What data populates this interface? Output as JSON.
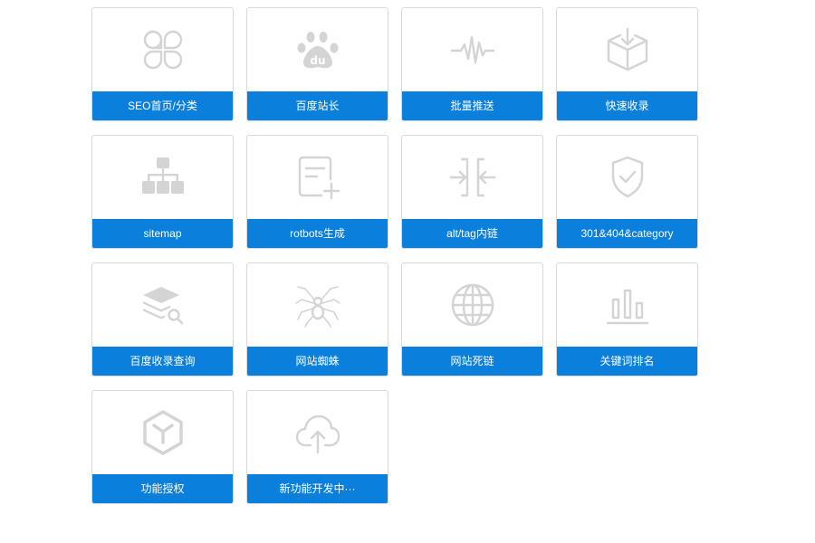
{
  "tools": [
    {
      "label": "SEO首页/分类",
      "icon": "clover-icon"
    },
    {
      "label": "百度站长",
      "icon": "baidu-paw-icon"
    },
    {
      "label": "批量推送",
      "icon": "pulse-wave-icon"
    },
    {
      "label": "快速收录",
      "icon": "box-download-icon"
    },
    {
      "label": "sitemap",
      "icon": "sitemap-icon"
    },
    {
      "label": "rotbots生成",
      "icon": "document-add-icon"
    },
    {
      "label": "alt/tag内链",
      "icon": "merge-arrows-icon"
    },
    {
      "label": "301&404&category",
      "icon": "shield-check-icon"
    },
    {
      "label": "百度收录查询",
      "icon": "layers-search-icon"
    },
    {
      "label": "网站蜘蛛",
      "icon": "spider-icon"
    },
    {
      "label": "网站死链",
      "icon": "globe-icon"
    },
    {
      "label": "关键词排名",
      "icon": "bar-chart-icon"
    },
    {
      "label": "功能授权",
      "icon": "hex-cube-icon"
    },
    {
      "label": "新功能开发中···",
      "icon": "cloud-upload-icon"
    }
  ],
  "colors": {
    "label_bg": "#0a7fdb",
    "label_text": "#ffffff",
    "icon": "#d4d4d4",
    "card_border": "#d9d9d9"
  }
}
